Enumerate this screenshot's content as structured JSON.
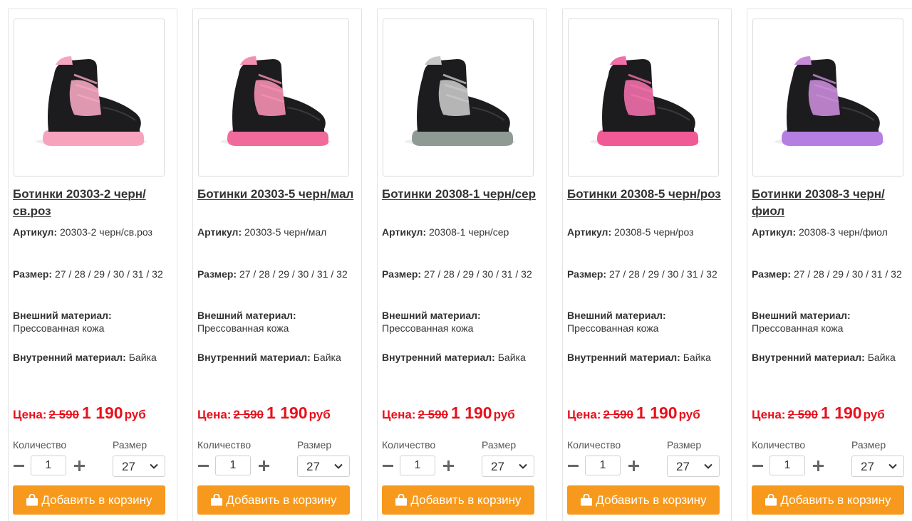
{
  "labels": {
    "article": "Артикул:",
    "size": "Размер:",
    "outer_material": "Внешний материал:",
    "inner_material": "Внутренний материал:",
    "price": "Цена:",
    "currency": "руб",
    "quantity": "Количество",
    "size_select": "Размер",
    "add_to_cart": "Добавить в корзину"
  },
  "colors": {
    "price_red": "#e8101c",
    "button_orange": "#f7991c"
  },
  "products": [
    {
      "title": "Ботинки 20303-2 черн/св.роз",
      "article": "20303-2 черн/св.роз",
      "sizes": "27 / 28 / 29 / 30 / 31 / 32",
      "outer_material": "Прессованная кожа",
      "inner_material": "Байка",
      "old_price": "2 590",
      "new_price": "1 190",
      "quantity": "1",
      "selected_size": "27",
      "accent": "#f4a6bf",
      "sole": "#f7a3bd"
    },
    {
      "title": "Ботинки 20303-5 черн/мал",
      "article": "20303-5 черн/мал",
      "sizes": "27 / 28 / 29 / 30 / 31 / 32",
      "outer_material": "Прессованная кожа",
      "inner_material": "Байка",
      "old_price": "2 590",
      "new_price": "1 190",
      "quantity": "1",
      "selected_size": "27",
      "accent": "#f58fb0",
      "sole": "#f06a9c"
    },
    {
      "title": "Ботинки 20308-1 черн/сер",
      "article": "20308-1 черн/сер",
      "sizes": "27 / 28 / 29 / 30 / 31 / 32",
      "outer_material": "Прессованная кожа",
      "inner_material": "Байка",
      "old_price": "2 590",
      "new_price": "1 190",
      "quantity": "1",
      "selected_size": "27",
      "accent": "#c7c7c7",
      "sole": "#8e9a94"
    },
    {
      "title": "Ботинки 20308-5 черн/роз",
      "article": "20308-5 черн/роз",
      "sizes": "27 / 28 / 29 / 30 / 31 / 32",
      "outer_material": "Прессованная кожа",
      "inner_material": "Байка",
      "old_price": "2 590",
      "new_price": "1 190",
      "quantity": "1",
      "selected_size": "27",
      "accent": "#f06fa8",
      "sole": "#f05a95"
    },
    {
      "title": "Ботинки 20308-3 черн/фиол",
      "article": "20308-3 черн/фиол",
      "sizes": "27 / 28 / 29 / 30 / 31 / 32",
      "outer_material": "Прессованная кожа",
      "inner_material": "Байка",
      "old_price": "2 590",
      "new_price": "1 190",
      "quantity": "1",
      "selected_size": "27",
      "accent": "#c88bd8",
      "sole": "#b47fe0"
    }
  ]
}
